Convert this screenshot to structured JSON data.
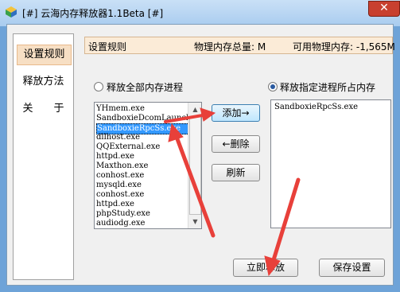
{
  "window": {
    "title": "[#] 云海内存释放器1.1Beta [#]",
    "close_glyph": "✕",
    "icon": "app-cube-icon"
  },
  "nav": {
    "items": [
      {
        "label": "设置规则",
        "selected": true
      },
      {
        "label": "释放方法",
        "selected": false
      },
      {
        "label": "关　　于",
        "selected": false
      }
    ]
  },
  "infobar": {
    "section": "设置规则",
    "total_label": "物理内存总量: M",
    "available_label": "可用物理内存: -1,565M"
  },
  "options": {
    "release_all_label": "释放全部内存进程",
    "release_selected_label": "释放指定进程所占内存",
    "selected_option": "release_selected"
  },
  "process_list": {
    "items": [
      "YHmem.exe",
      "SandboxieDcomLaunch",
      "SandboxieRpcSs.exe",
      "dllhost.exe",
      "QQExternal.exe",
      "httpd.exe",
      "Maxthon.exe",
      "conhost.exe",
      "mysqld.exe",
      "conhost.exe",
      "httpd.exe",
      "phpStudy.exe",
      "audiodg.exe"
    ],
    "selected_index": 2
  },
  "buttons": {
    "add": "添加→",
    "delete": "←删除",
    "refresh": "刷新",
    "release_now": "立即释放",
    "save": "保存设置"
  },
  "selected_list": {
    "items": [
      "SandboxieRpcSs.exe"
    ]
  },
  "colors": {
    "arrow": "#e8403a",
    "selection": "#3399ff",
    "nav_selected": "#f7dfc4"
  }
}
